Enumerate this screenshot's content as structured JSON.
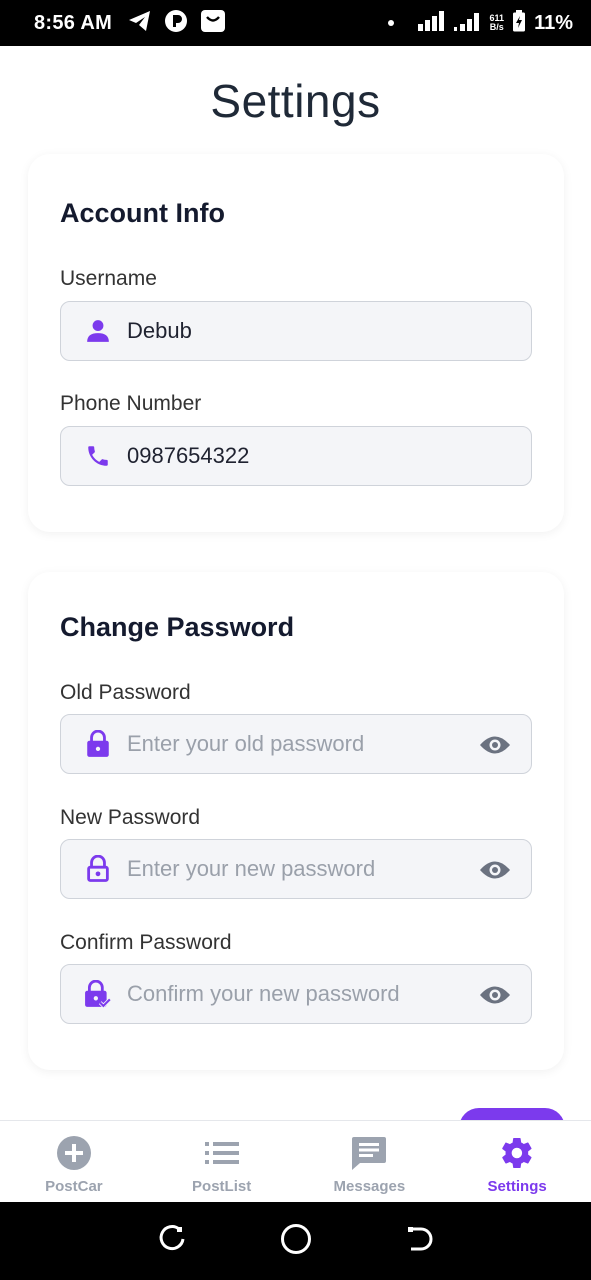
{
  "status_bar": {
    "time": "8:56 AM",
    "net_speed_value": "611",
    "net_speed_unit": "B/s",
    "battery_percent": "11%"
  },
  "page": {
    "title": "Settings"
  },
  "account_info": {
    "heading": "Account Info",
    "username_label": "Username",
    "username_value": "Debub",
    "phone_label": "Phone Number",
    "phone_value": "0987654322"
  },
  "change_password": {
    "heading": "Change Password",
    "old_label": "Old Password",
    "old_placeholder": "Enter your old password",
    "new_label": "New Password",
    "new_placeholder": "Enter your new password",
    "confirm_label": "Confirm Password",
    "confirm_placeholder": "Confirm your new password"
  },
  "bottom_nav": {
    "items": [
      {
        "label": "PostCar",
        "icon": "add-circle-icon"
      },
      {
        "label": "PostList",
        "icon": "list-icon"
      },
      {
        "label": "Messages",
        "icon": "message-icon"
      },
      {
        "label": "Settings",
        "icon": "gear-icon"
      }
    ],
    "active": "Settings"
  },
  "colors": {
    "accent": "#7c3aed",
    "inactive": "#9ca3af",
    "text_dark": "#141a2e"
  }
}
